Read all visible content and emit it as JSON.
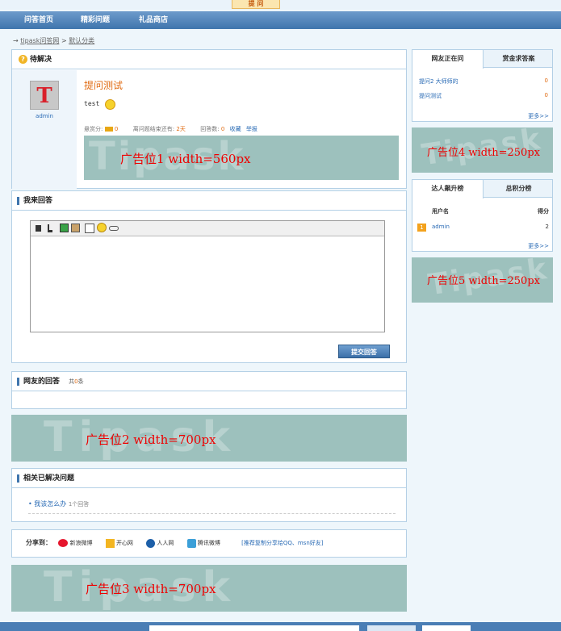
{
  "top": {
    "ask_tab": "提 问"
  },
  "nav": [
    "问答首页",
    "精彩问题",
    "礼品商店"
  ],
  "breadcrumb": {
    "arrow": "→",
    "home": "tipask问答网",
    "sep": ">",
    "category": "默认分类"
  },
  "question_box": {
    "header": "待解决",
    "user_initial": "T",
    "username": "admin",
    "title": "提问测试",
    "body": "test",
    "reward_label": "悬赏分:",
    "reward_value": "0",
    "time_label": "离问题结束还有:",
    "time_value": "2天",
    "answers_label": "回答数:",
    "answers_value": "0",
    "favorite": "收藏",
    "report": "举报"
  },
  "ads": {
    "ad1": "广告位1    width=560px",
    "ad2": "广告位2    width=700px",
    "ad3": "广告位3    width=700px",
    "ad4": "广告位4 width=250px",
    "ad5": "广告位5    width=250px",
    "watermark": "Tipask"
  },
  "answer_box": {
    "header": "我来回答",
    "submit": "提交回答"
  },
  "netizen_answers": {
    "header": "网友的回答",
    "total_prefix": "共",
    "total_value": "0",
    "total_suffix": "条"
  },
  "related": {
    "header": "相关已解决问题",
    "item_title": "我该怎么办",
    "item_count": "1个回答"
  },
  "share": {
    "label": "分享到：",
    "items": [
      "新浪微博",
      "开心网",
      "人人网",
      "腾讯微博"
    ],
    "recommend": "[推荐复制分享给QQ、msn好友]"
  },
  "right_asking": {
    "tab_active": "网友正在问",
    "tab_other": "赏金求答案",
    "items": [
      {
        "title": "提问2 大师师的",
        "count": "0"
      },
      {
        "title": "提问测试",
        "count": "0"
      }
    ],
    "more": "更多>>"
  },
  "right_rank": {
    "tab_active": "达人飙升榜",
    "tab_other": "总积分榜",
    "col_user": "用户名",
    "col_score": "得分",
    "rows": [
      {
        "rank": "1",
        "name": "admin",
        "score": "2"
      }
    ],
    "more": "更多>>"
  },
  "colors": {
    "nav": "#3f75ad",
    "border": "#b4d0e6",
    "ad_bg": "#9dc1bd",
    "ad_text": "#ee0000",
    "title": "#e06a10"
  },
  "icons": [
    "question-icon",
    "smile-icon",
    "coin-icon",
    "sina-weibo-icon",
    "kaixin-icon",
    "renren-icon",
    "tencent-weibo-icon"
  ]
}
